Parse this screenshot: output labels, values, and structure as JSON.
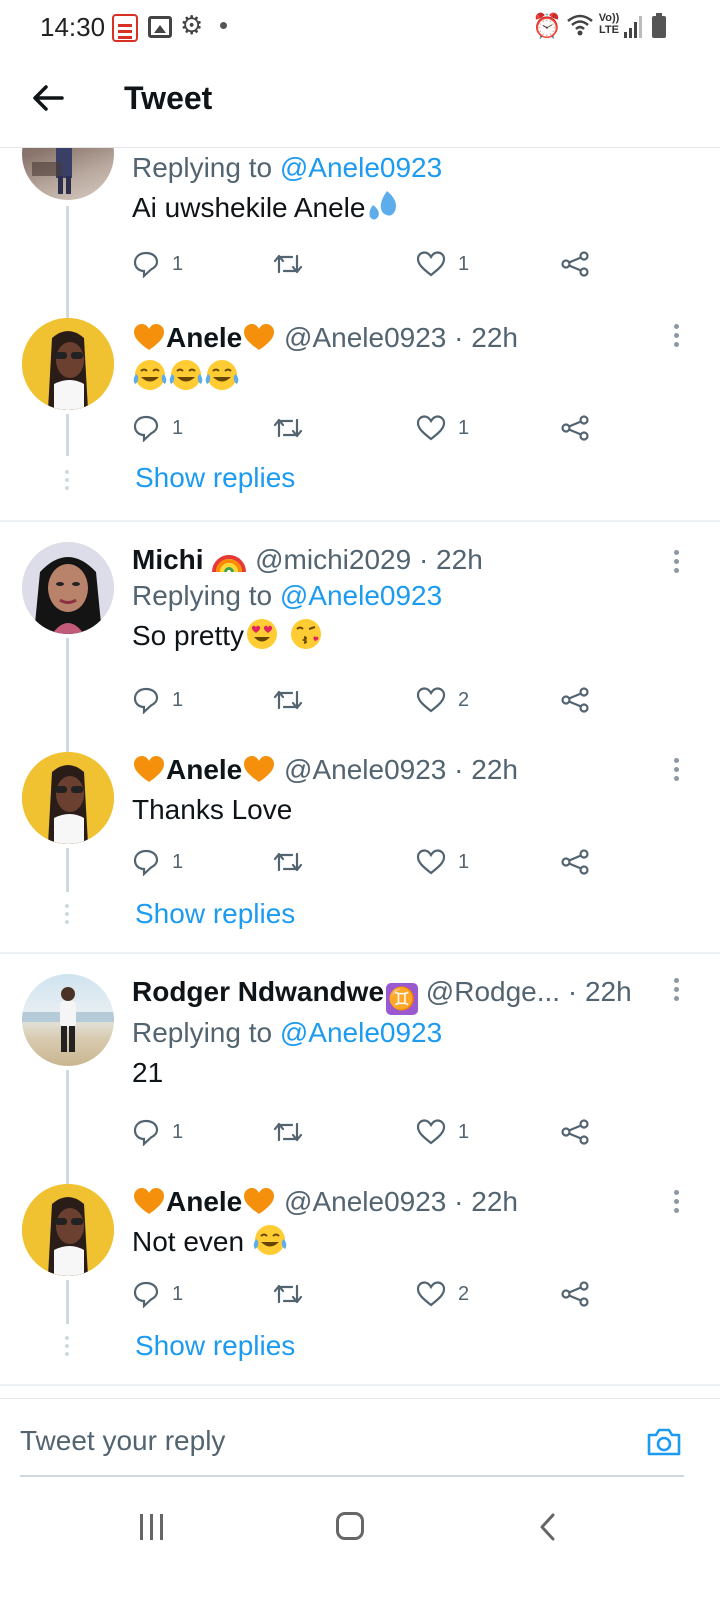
{
  "status_bar": {
    "time": "14:30",
    "lte_label": "Vo)) LTE"
  },
  "header": {
    "title": "Tweet"
  },
  "tweets": [
    {
      "replying_label": "Replying to",
      "replying_to": "@Anele0923",
      "text": "Ai uwshekile Anele",
      "replies": "1",
      "likes": "1"
    },
    {
      "name": "Anele",
      "handle": "@Anele0923 · 22h",
      "text": "",
      "replies": "1",
      "likes": "1",
      "show_replies": "Show replies"
    },
    {
      "name": "Michi",
      "handle": "@michi2029 · 22h",
      "replying_label": "Replying to",
      "replying_to": "@Anele0923",
      "text": "So pretty",
      "replies": "1",
      "likes": "2"
    },
    {
      "name": "Anele",
      "handle": "@Anele0923 · 22h",
      "text": "Thanks Love",
      "replies": "1",
      "likes": "1",
      "show_replies": "Show replies"
    },
    {
      "name": "Rodger Ndwandwe",
      "handle": "@Rodge... · 22h",
      "replying_label": "Replying to",
      "replying_to": "@Anele0923",
      "text": "21",
      "replies": "1",
      "likes": "1"
    },
    {
      "name": "Anele",
      "handle": "@Anele0923 · 22h",
      "text": "Not even",
      "replies": "1",
      "likes": "2",
      "show_replies": "Show replies"
    }
  ],
  "emoji": {
    "gemini": "♊"
  },
  "composer": {
    "placeholder": "Tweet your reply"
  },
  "colors": {
    "accent": "#1d9bf0",
    "secondary_text": "#536471",
    "heart_orange": "#f4900c"
  }
}
